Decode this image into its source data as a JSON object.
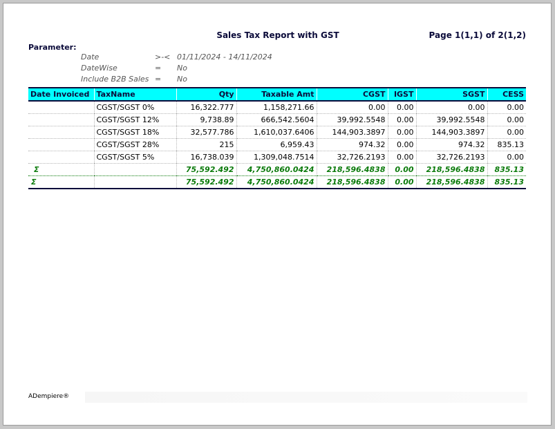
{
  "report": {
    "title": "Sales Tax Report with GST",
    "page_info": "Page 1(1,1) of 2(1,2)"
  },
  "parameters": {
    "heading": "Parameter:",
    "items": [
      {
        "name": "Date",
        "op": ">-<",
        "value": "01/11/2024 - 14/11/2024"
      },
      {
        "name": "DateWise",
        "op": "=",
        "value": "No"
      },
      {
        "name": "Include B2B Sales",
        "op": "=",
        "value": "No"
      }
    ]
  },
  "table": {
    "columns": [
      "Date Invoiced",
      "TaxName",
      "Qty",
      "Taxable Amt",
      "CGST",
      "IGST",
      "SGST",
      "CESS"
    ],
    "rows": [
      [
        "",
        "CGST/SGST 0%",
        "16,322.777",
        "1,158,271.66",
        "0.00",
        "0.00",
        "0.00",
        "0.00"
      ],
      [
        "",
        "CGST/SGST 12%",
        "9,738.89",
        "666,542.5604",
        "39,992.5548",
        "0.00",
        "39,992.5548",
        "0.00"
      ],
      [
        "",
        "CGST/SGST 18%",
        "32,577.786",
        "1,610,037.6406",
        "144,903.3897",
        "0.00",
        "144,903.3897",
        "0.00"
      ],
      [
        "",
        "CGST/SGST 28%",
        "215",
        "6,959.43",
        "974.32",
        "0.00",
        "974.32",
        "835.13"
      ],
      [
        "",
        "CGST/SGST 5%",
        "16,738.039",
        "1,309,048.7514",
        "32,726.2193",
        "0.00",
        "32,726.2193",
        "0.00"
      ]
    ],
    "sum_rows": [
      {
        "symbol": "Σ",
        "qty": "75,592.492",
        "taxable": "4,750,860.0424",
        "cgst": "218,596.4838",
        "igst": "0.00",
        "sgst": "218,596.4838",
        "cess": "835.13"
      },
      {
        "symbol": "Σ",
        "qty": "75,592.492",
        "taxable": "4,750,860.0424",
        "cgst": "218,596.4838",
        "igst": "0.00",
        "sgst": "218,596.4838",
        "cess": "835.13"
      }
    ]
  },
  "footer": {
    "brand": "ADempiere®"
  },
  "colors": {
    "header_bg": "#00ffff",
    "sum_text": "#0a7a0a",
    "heading_text": "#0b0b3a"
  }
}
